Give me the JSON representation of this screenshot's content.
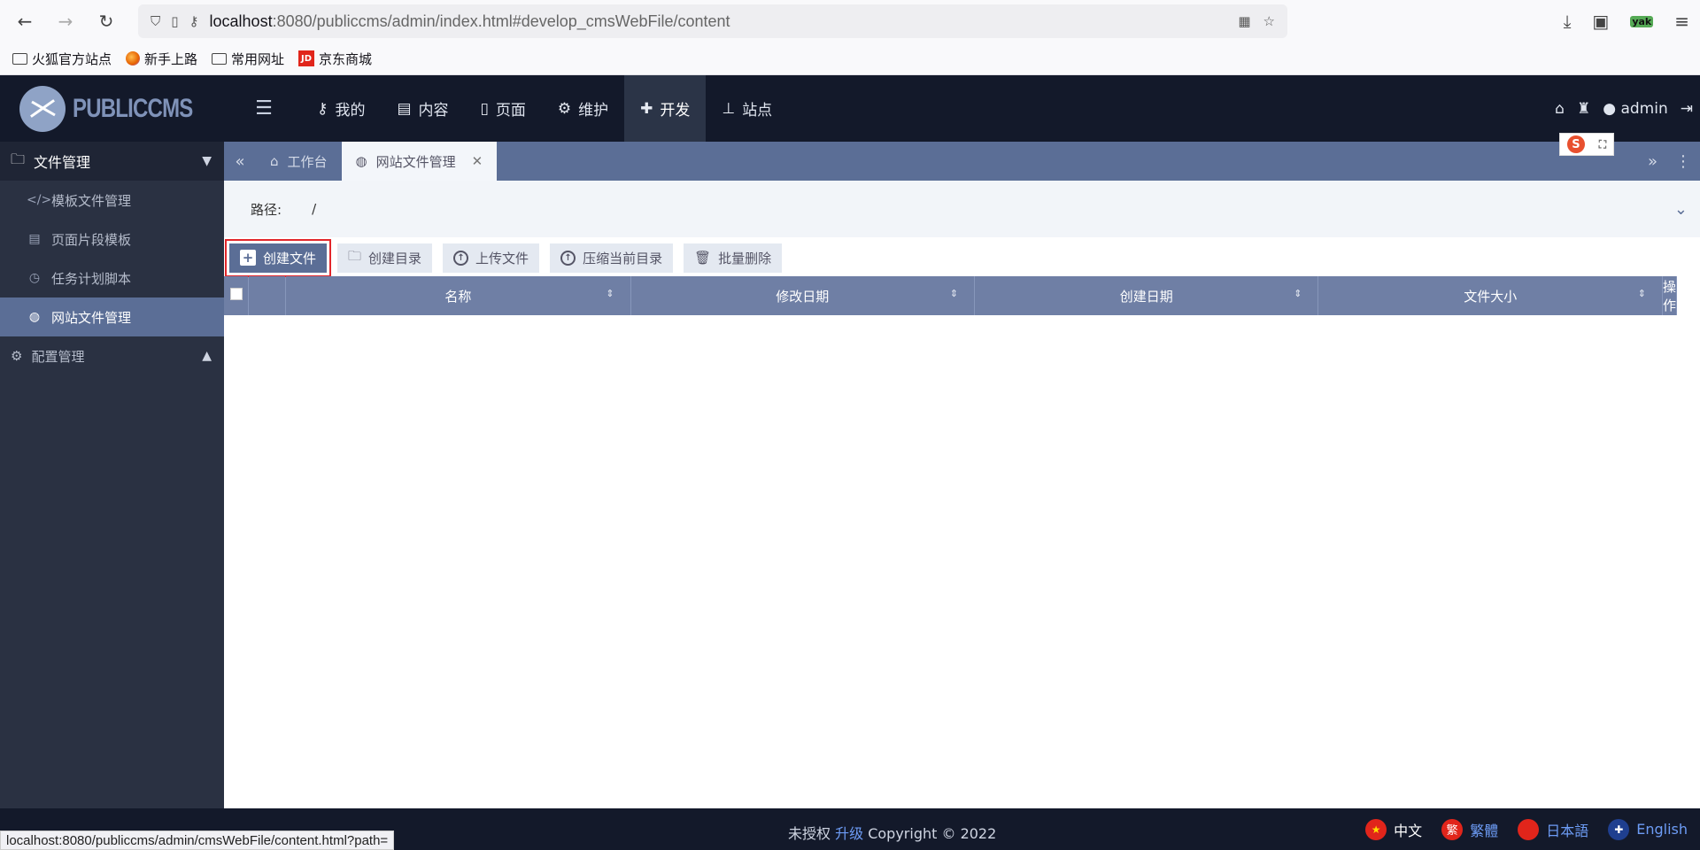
{
  "browser": {
    "url_host": "localhost",
    "url_rest": ":8080/publiccms/admin/index.html#develop_cmsWebFile/content",
    "bookmarks": [
      "火狐官方站点",
      "新手上路",
      "常用网址",
      "京东商城"
    ],
    "jd_badge": "JD",
    "ext_badge": "yak"
  },
  "header": {
    "logo_text": "PUBLICCMS",
    "nav": [
      "我的",
      "内容",
      "页面",
      "维护",
      "开发",
      "站点"
    ],
    "active_nav": "开发",
    "user": "admin"
  },
  "sidebar": {
    "group": "文件管理",
    "items": [
      "模板文件管理",
      "页面片段模板",
      "任务计划脚本",
      "网站文件管理"
    ],
    "active_item": "网站文件管理",
    "group2": "配置管理"
  },
  "tabs": [
    "工作台",
    "网站文件管理"
  ],
  "ime_badge": "S",
  "path": {
    "label": "路径:",
    "value": "/"
  },
  "toolbar": [
    "创建文件",
    "创建目录",
    "上传文件",
    "压缩当前目录",
    "批量删除"
  ],
  "table": {
    "columns": [
      "名称",
      "修改日期",
      "创建日期",
      "文件大小",
      "操作"
    ]
  },
  "footer": {
    "unlicensed": "未授权",
    "upgrade": "升级",
    "copyright": "Copyright © 2022",
    "languages": [
      "中文",
      "繁體",
      "日本語",
      "English"
    ],
    "tw_flag_glyph": "繁"
  },
  "status_url": "localhost:8080/publiccms/admin/cmsWebFile/content.html?path=",
  "colors": {
    "primary": "#5b6e96",
    "header_bg": "#13192a",
    "highlight": "#e2262b"
  }
}
